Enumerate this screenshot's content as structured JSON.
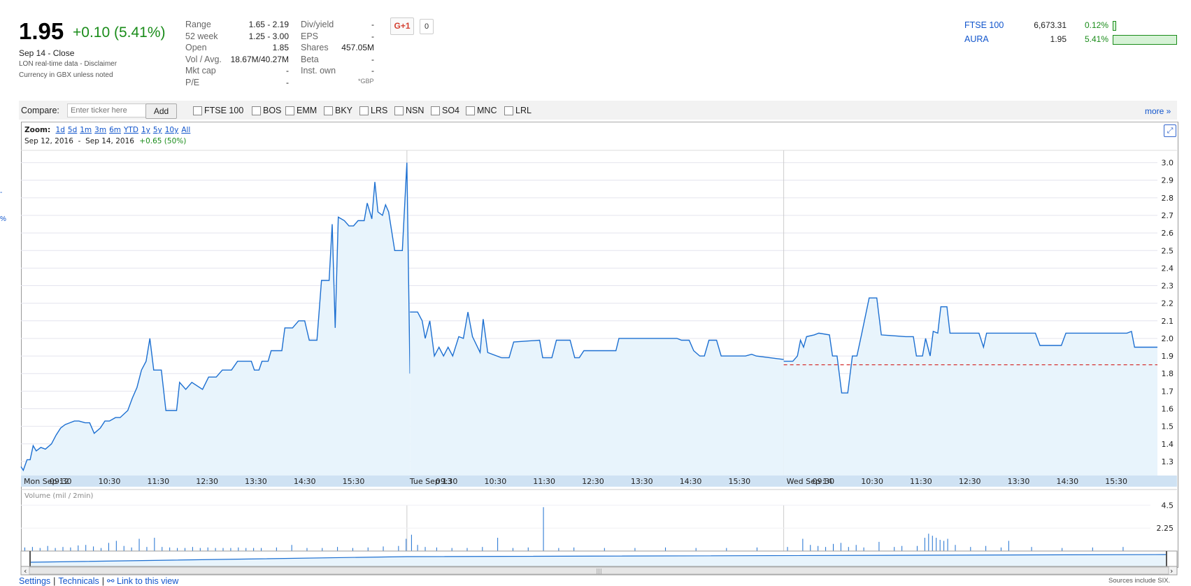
{
  "quote": {
    "price": "1.95",
    "change": "+0.10 (5.41%)",
    "close_label": "Sep 14 - Close",
    "realtime_note": "LON real-time data - Disclaimer",
    "currency_note": "Currency in GBX unless noted"
  },
  "stats_left": [
    {
      "label": "Range",
      "value": "1.65 - 2.19"
    },
    {
      "label": "52 week",
      "value": "1.25 - 3.00"
    },
    {
      "label": "Open",
      "value": "1.85"
    },
    {
      "label": "Vol / Avg.",
      "value": "18.67M/40.27M"
    },
    {
      "label": "Mkt cap",
      "value": "-"
    },
    {
      "label": "P/E",
      "value": "-"
    }
  ],
  "stats_right": [
    {
      "label": "Div/yield",
      "value": "-"
    },
    {
      "label": "EPS",
      "value": "-"
    },
    {
      "label": "Shares",
      "value": "457.05M"
    },
    {
      "label": "Beta",
      "value": "-"
    },
    {
      "label": "Inst. own",
      "value": "-"
    }
  ],
  "gbp_note": "*GBP",
  "social": {
    "gplus_label": "G+1",
    "count": "0"
  },
  "indices": [
    {
      "name": "FTSE 100",
      "value": "6,673.31",
      "change": "0.12%",
      "bar_fraction": 0.02
    },
    {
      "name": "AURA",
      "value": "1.95",
      "change": "5.41%",
      "bar_fraction": 1.0
    }
  ],
  "compare": {
    "label": "Compare:",
    "placeholder": "Enter ticker here",
    "add_label": "Add",
    "tickers": [
      "FTSE 100",
      "BOS",
      "EMM",
      "BKY",
      "LRS",
      "NSN",
      "SO4",
      "MNC",
      "LRL"
    ],
    "more_label": "more »"
  },
  "zoom": {
    "label": "Zoom:",
    "options": [
      "1d",
      "5d",
      "1m",
      "3m",
      "6m",
      "YTD",
      "1y",
      "5y",
      "10y",
      "All"
    ]
  },
  "range": {
    "from": "Sep 12, 2016",
    "sep": "-",
    "to": "Sep 14, 2016",
    "change": "+0.65 (50%)"
  },
  "left_edge_marks": [
    "-",
    "%"
  ],
  "chart_data": {
    "type": "line",
    "title": "",
    "ylim": [
      1.22,
      3.07
    ],
    "y_ticks": [
      "3.0",
      "2.9",
      "2.8",
      "2.7",
      "2.6",
      "2.5",
      "2.4",
      "2.3",
      "2.2",
      "2.1",
      "2.0",
      "1.9",
      "1.8",
      "1.7",
      "1.6",
      "1.5",
      "1.4",
      "1.3"
    ],
    "x_tick_labels": [
      "Mon Sep 12",
      "09:30",
      "10:30",
      "11:30",
      "12:30",
      "13:30",
      "14:30",
      "15:30",
      "Tue Sep 13",
      "09:30",
      "10:30",
      "11:30",
      "12:30",
      "13:30",
      "14:30",
      "15:30",
      "Wed Sep 14",
      "09:30",
      "10:30",
      "11:30",
      "12:30",
      "13:30",
      "14:30",
      "15:30"
    ],
    "day_breaks_after_index": [
      8,
      16
    ],
    "previous_close": 1.85,
    "series": [
      {
        "points": [
          [
            0,
            1.27
          ],
          [
            0.3,
            1.25
          ],
          [
            0.8,
            1.31
          ],
          [
            1.2,
            1.31
          ],
          [
            1.6,
            1.39
          ],
          [
            2.0,
            1.36
          ],
          [
            2.6,
            1.38
          ],
          [
            3.2,
            1.37
          ],
          [
            4.0,
            1.4
          ],
          [
            4.6,
            1.45
          ],
          [
            5.2,
            1.49
          ],
          [
            5.8,
            1.51
          ],
          [
            6.4,
            1.52
          ],
          [
            7.0,
            1.53
          ],
          [
            7.6,
            1.53
          ],
          [
            8.4,
            1.52
          ],
          [
            9.0,
            1.52
          ],
          [
            9.6,
            1.46
          ],
          [
            10.4,
            1.49
          ],
          [
            11.0,
            1.53
          ],
          [
            11.6,
            1.53
          ],
          [
            12.4,
            1.55
          ],
          [
            13.0,
            1.55
          ],
          [
            14.0,
            1.59
          ],
          [
            14.6,
            1.66
          ],
          [
            15.2,
            1.72
          ],
          [
            15.8,
            1.82
          ],
          [
            16.4,
            1.87
          ],
          [
            16.9,
            2.0
          ],
          [
            17.4,
            1.82
          ],
          [
            18.4,
            1.82
          ],
          [
            19.0,
            1.59
          ],
          [
            20.4,
            1.59
          ],
          [
            20.8,
            1.75
          ],
          [
            21.6,
            1.71
          ],
          [
            22.4,
            1.75
          ],
          [
            23.8,
            1.71
          ],
          [
            24.6,
            1.78
          ],
          [
            25.6,
            1.78
          ],
          [
            26.4,
            1.82
          ],
          [
            27.6,
            1.82
          ],
          [
            28.4,
            1.87
          ],
          [
            30.2,
            1.87
          ],
          [
            30.6,
            1.82
          ],
          [
            31.2,
            1.82
          ],
          [
            31.6,
            1.87
          ],
          [
            32.4,
            1.87
          ],
          [
            32.8,
            1.93
          ],
          [
            34.2,
            1.93
          ],
          [
            34.6,
            2.06
          ],
          [
            35.6,
            2.06
          ],
          [
            36.4,
            2.1
          ],
          [
            37.2,
            2.1
          ],
          [
            37.8,
            1.99
          ],
          [
            38.8,
            1.99
          ],
          [
            39.4,
            2.33
          ],
          [
            40.4,
            2.33
          ],
          [
            40.8,
            2.65
          ],
          [
            41.2,
            2.06
          ],
          [
            41.6,
            2.69
          ],
          [
            42.4,
            2.67
          ],
          [
            43.0,
            2.64
          ],
          [
            43.6,
            2.64
          ],
          [
            44.2,
            2.67
          ],
          [
            45.0,
            2.67
          ],
          [
            45.4,
            2.77
          ],
          [
            46.0,
            2.68
          ],
          [
            46.4,
            2.89
          ],
          [
            46.8,
            2.72
          ],
          [
            47.4,
            2.7
          ],
          [
            47.8,
            2.76
          ],
          [
            48.2,
            2.72
          ],
          [
            49.0,
            2.5
          ],
          [
            50.0,
            2.5
          ],
          [
            50.6,
            3.0
          ],
          [
            51.0,
            1.8
          ]
        ]
      },
      {
        "points": [
          [
            51.0,
            2.15
          ],
          [
            52.0,
            2.15
          ],
          [
            52.6,
            2.1
          ],
          [
            53.0,
            2.0
          ],
          [
            53.6,
            2.1
          ],
          [
            54.2,
            1.9
          ],
          [
            54.8,
            1.95
          ],
          [
            55.4,
            1.9
          ],
          [
            56.0,
            1.95
          ],
          [
            56.6,
            1.9
          ],
          [
            57.4,
            2.01
          ],
          [
            58.0,
            2.0
          ],
          [
            58.6,
            2.15
          ],
          [
            59.2,
            2.01
          ],
          [
            60.2,
            1.92
          ],
          [
            60.6,
            2.11
          ],
          [
            61.2,
            1.92
          ],
          [
            63.0,
            1.89
          ],
          [
            64.0,
            1.89
          ],
          [
            64.6,
            1.98
          ],
          [
            68.0,
            1.99
          ],
          [
            68.4,
            1.89
          ],
          [
            69.6,
            1.89
          ],
          [
            70.2,
            1.99
          ],
          [
            72.0,
            1.99
          ],
          [
            72.6,
            1.89
          ],
          [
            73.2,
            1.89
          ],
          [
            73.8,
            1.93
          ],
          [
            78.0,
            1.93
          ],
          [
            78.4,
            2.0
          ],
          [
            86.0,
            2.0
          ],
          [
            86.6,
            1.99
          ],
          [
            87.6,
            1.99
          ],
          [
            88.2,
            1.93
          ],
          [
            89.0,
            1.9
          ],
          [
            89.6,
            1.9
          ],
          [
            90.2,
            1.99
          ],
          [
            91.2,
            1.99
          ],
          [
            91.8,
            1.9
          ],
          [
            95.0,
            1.9
          ],
          [
            95.8,
            1.91
          ],
          [
            96.4,
            1.9
          ],
          [
            100.0,
            1.88
          ]
        ]
      },
      {
        "points": [
          [
            100.0,
            1.87
          ],
          [
            101.2,
            1.87
          ],
          [
            101.8,
            1.9
          ],
          [
            102.2,
            1.99
          ],
          [
            102.6,
            1.95
          ],
          [
            103.0,
            2.01
          ],
          [
            104.0,
            2.02
          ],
          [
            104.6,
            2.03
          ],
          [
            106.0,
            2.02
          ],
          [
            106.4,
            1.9
          ],
          [
            107.0,
            1.9
          ],
          [
            107.6,
            1.69
          ],
          [
            108.4,
            1.69
          ],
          [
            109.0,
            1.9
          ],
          [
            109.6,
            1.9
          ],
          [
            110.2,
            2.02
          ],
          [
            111.2,
            2.23
          ],
          [
            112.2,
            2.23
          ],
          [
            112.8,
            2.02
          ],
          [
            116.0,
            2.01
          ],
          [
            117.0,
            2.01
          ],
          [
            117.4,
            1.9
          ],
          [
            118.2,
            1.9
          ],
          [
            118.6,
            2.0
          ],
          [
            119.2,
            1.9
          ],
          [
            119.6,
            2.04
          ],
          [
            120.2,
            2.03
          ],
          [
            120.6,
            2.18
          ],
          [
            121.4,
            2.18
          ],
          [
            121.8,
            2.03
          ],
          [
            125.6,
            2.03
          ],
          [
            126.2,
            1.95
          ],
          [
            126.6,
            2.03
          ],
          [
            133.0,
            2.03
          ],
          [
            133.6,
            1.96
          ],
          [
            136.4,
            1.96
          ],
          [
            137.0,
            2.03
          ],
          [
            145.0,
            2.03
          ],
          [
            145.6,
            2.04
          ],
          [
            146.0,
            1.95
          ],
          [
            149.0,
            1.95
          ]
        ]
      }
    ],
    "volume": {
      "label": "Volume (mil / 2min)",
      "y_ticks": [
        "4.5",
        "2.25"
      ],
      "ylim": [
        0,
        4.8
      ],
      "bars": [
        [
          0.5,
          0.35
        ],
        [
          1.5,
          0.4
        ],
        [
          2.5,
          0.3
        ],
        [
          3.5,
          0.5
        ],
        [
          4.5,
          0.3
        ],
        [
          5.5,
          0.4
        ],
        [
          6.5,
          0.35
        ],
        [
          7.5,
          0.55
        ],
        [
          8.5,
          0.6
        ],
        [
          9.5,
          0.45
        ],
        [
          10.5,
          0.3
        ],
        [
          11.5,
          0.8
        ],
        [
          12.5,
          1.0
        ],
        [
          13.5,
          0.5
        ],
        [
          14.5,
          0.35
        ],
        [
          15.5,
          1.2
        ],
        [
          16.5,
          0.4
        ],
        [
          17.5,
          1.3
        ],
        [
          18.5,
          0.4
        ],
        [
          19.5,
          0.35
        ],
        [
          20.5,
          0.3
        ],
        [
          21.5,
          0.3
        ],
        [
          22.5,
          0.4
        ],
        [
          23.5,
          0.3
        ],
        [
          24.5,
          0.35
        ],
        [
          25.5,
          0.3
        ],
        [
          26.5,
          0.3
        ],
        [
          27.5,
          0.3
        ],
        [
          28.5,
          0.35
        ],
        [
          29.5,
          0.3
        ],
        [
          30.5,
          0.3
        ],
        [
          31.5,
          0.3
        ],
        [
          33.5,
          0.35
        ],
        [
          35.5,
          0.6
        ],
        [
          37.5,
          0.3
        ],
        [
          39.5,
          0.3
        ],
        [
          41.5,
          0.4
        ],
        [
          43.5,
          0.3
        ],
        [
          45.5,
          0.35
        ],
        [
          47.5,
          0.45
        ],
        [
          49.5,
          0.5
        ],
        [
          50.5,
          1.2
        ],
        [
          51.2,
          1.6
        ],
        [
          52.0,
          0.6
        ],
        [
          53.0,
          0.4
        ],
        [
          54.5,
          0.35
        ],
        [
          56.5,
          0.3
        ],
        [
          58.5,
          0.3
        ],
        [
          60.5,
          0.4
        ],
        [
          62.5,
          1.3
        ],
        [
          64.5,
          0.3
        ],
        [
          66.5,
          0.35
        ],
        [
          68.5,
          4.3
        ],
        [
          70.5,
          0.3
        ],
        [
          72.5,
          0.35
        ],
        [
          76.5,
          0.3
        ],
        [
          80.5,
          0.3
        ],
        [
          84.5,
          0.35
        ],
        [
          88.5,
          0.3
        ],
        [
          92.5,
          0.3
        ],
        [
          96.5,
          0.35
        ],
        [
          100.5,
          0.4
        ],
        [
          102.5,
          1.2
        ],
        [
          103.5,
          0.6
        ],
        [
          104.5,
          0.5
        ],
        [
          105.5,
          0.4
        ],
        [
          106.5,
          0.7
        ],
        [
          107.5,
          0.8
        ],
        [
          108.5,
          0.4
        ],
        [
          109.5,
          0.6
        ],
        [
          110.5,
          0.35
        ],
        [
          112.5,
          0.9
        ],
        [
          114.5,
          0.4
        ],
        [
          115.5,
          0.5
        ],
        [
          117.5,
          0.5
        ],
        [
          118.5,
          1.3
        ],
        [
          119.0,
          1.7
        ],
        [
          119.5,
          1.5
        ],
        [
          120.0,
          1.3
        ],
        [
          120.5,
          1.1
        ],
        [
          121.0,
          1.0
        ],
        [
          121.5,
          1.2
        ],
        [
          122.5,
          0.6
        ],
        [
          124.5,
          0.4
        ],
        [
          126.5,
          0.5
        ],
        [
          128.5,
          0.35
        ],
        [
          129.5,
          1.0
        ],
        [
          132.5,
          0.4
        ],
        [
          136.5,
          0.3
        ],
        [
          140.5,
          0.35
        ],
        [
          144.5,
          0.4
        ]
      ]
    }
  },
  "footer": {
    "settings": "Settings",
    "technicals": "Technicals",
    "link_view": "Link to this view",
    "sources": "Sources include SIX."
  }
}
